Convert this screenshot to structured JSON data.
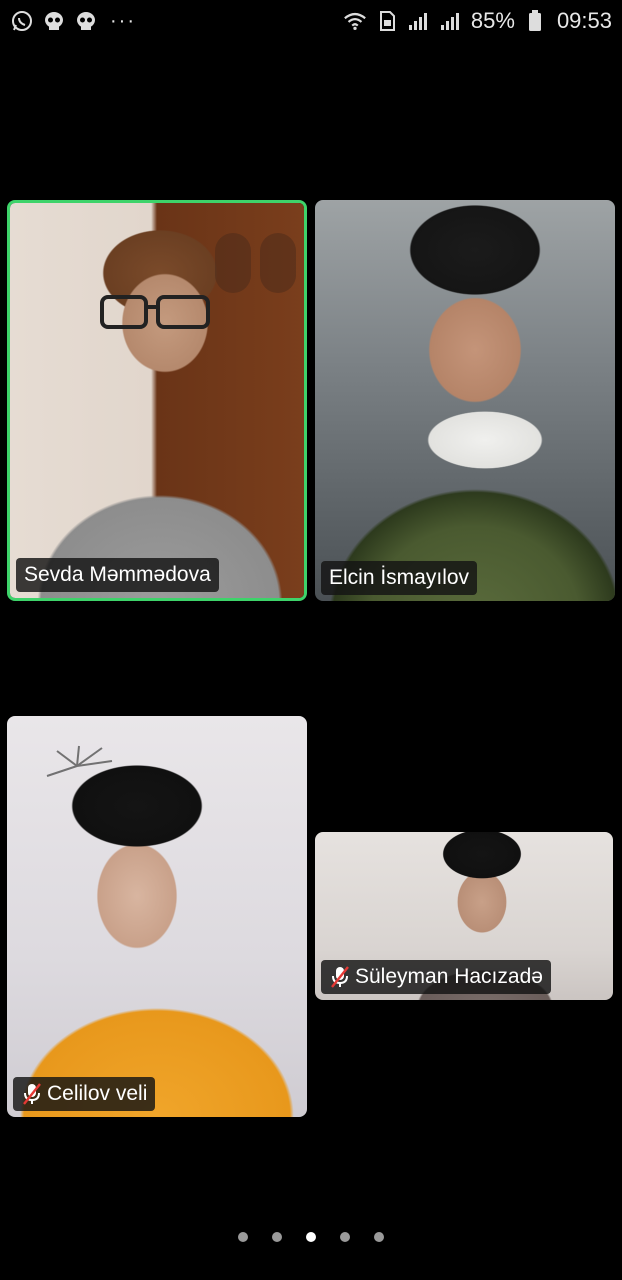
{
  "status_bar": {
    "left_icons": [
      "whatsapp-icon",
      "skull-icon",
      "skull-icon"
    ],
    "more": "···",
    "battery_percent": "85%",
    "time": "09:53"
  },
  "participants": [
    {
      "name": "Sevda Məmmədova",
      "muted": false,
      "active_speaker": true
    },
    {
      "name": "Elcin İsmayılov",
      "muted": false,
      "active_speaker": false
    },
    {
      "name": "Celilov veli",
      "muted": true,
      "active_speaker": false
    },
    {
      "name": "Süleyman Hacızadə",
      "muted": true,
      "active_speaker": false
    }
  ],
  "pager": {
    "total": 5,
    "current": 3
  },
  "colors": {
    "active_border": "#3ed36a",
    "background": "#000000"
  }
}
